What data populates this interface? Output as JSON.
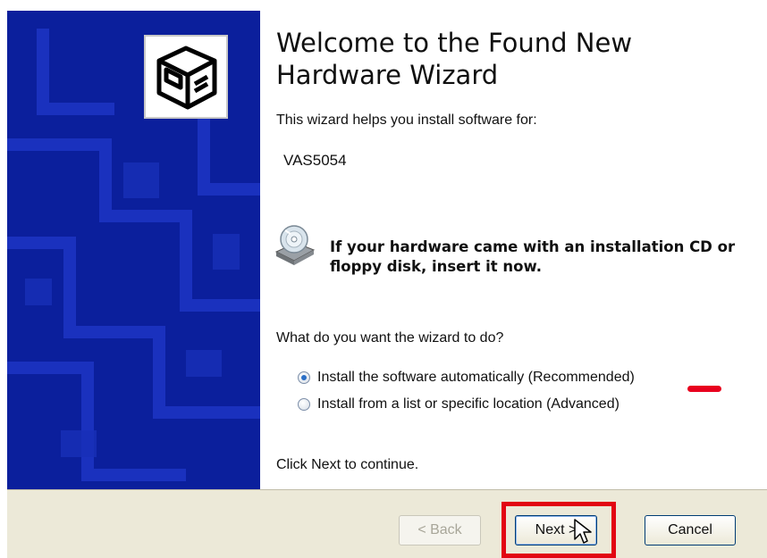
{
  "wizard": {
    "title": "Welcome to the Found New Hardware Wizard",
    "intro": "This wizard helps you install software for:",
    "device_name": "VAS5054",
    "cd_prompt": "If your hardware came with an installation CD or floppy disk, insert it now.",
    "question": "What do you want the wizard to do?",
    "options": [
      {
        "label": "Install the software automatically (Recommended)",
        "selected": true
      },
      {
        "label": "Install from a list or specific location (Advanced)",
        "selected": false
      }
    ],
    "footer": "Click Next to continue."
  },
  "buttons": {
    "back": "< Back",
    "next": "Next >",
    "cancel": "Cancel"
  },
  "colors": {
    "banner": "#0b1f9c",
    "annotation_red": "#e20613"
  },
  "icons": {
    "banner": "hardware-box-icon",
    "cd": "cd-rom-icon",
    "pointer": "mouse-pointer-icon"
  }
}
